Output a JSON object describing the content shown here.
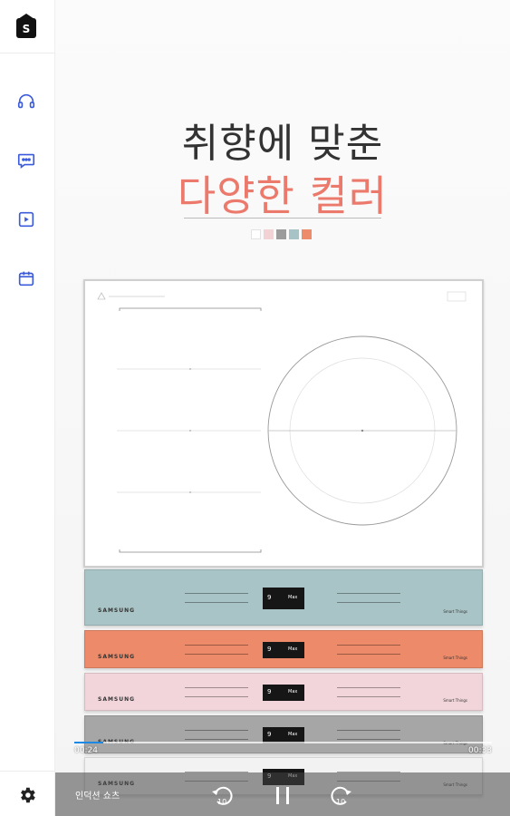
{
  "sidebar": {
    "logo_letter": "S",
    "icons": [
      "headset-icon",
      "chat-icon",
      "media-icon",
      "calendar-icon"
    ],
    "settings_icon": "gear-icon"
  },
  "hero": {
    "line1": "취향에 맞춘",
    "line2": "다양한 컬러",
    "accent_color": "#ec7a6c",
    "swatch_colors": [
      "#ffffff",
      "#f3d2d6",
      "#9c9c9c",
      "#a7c3c6",
      "#ed8c6c"
    ]
  },
  "cooktop": {
    "band_colors": [
      "#a8c4c6",
      "#ec8a69",
      "#f2d5da",
      "#a6a6a6",
      "#f2f2f2"
    ],
    "brand": "SAMSUNG",
    "display_digit": "9",
    "display_label": "Max",
    "band_tag": "Smart Things"
  },
  "player": {
    "time_current": "00:24",
    "time_total": "00:33",
    "progress": 0.07,
    "title": "인덕션 쇼츠",
    "rewind_label": "10",
    "forward_label": "10"
  }
}
